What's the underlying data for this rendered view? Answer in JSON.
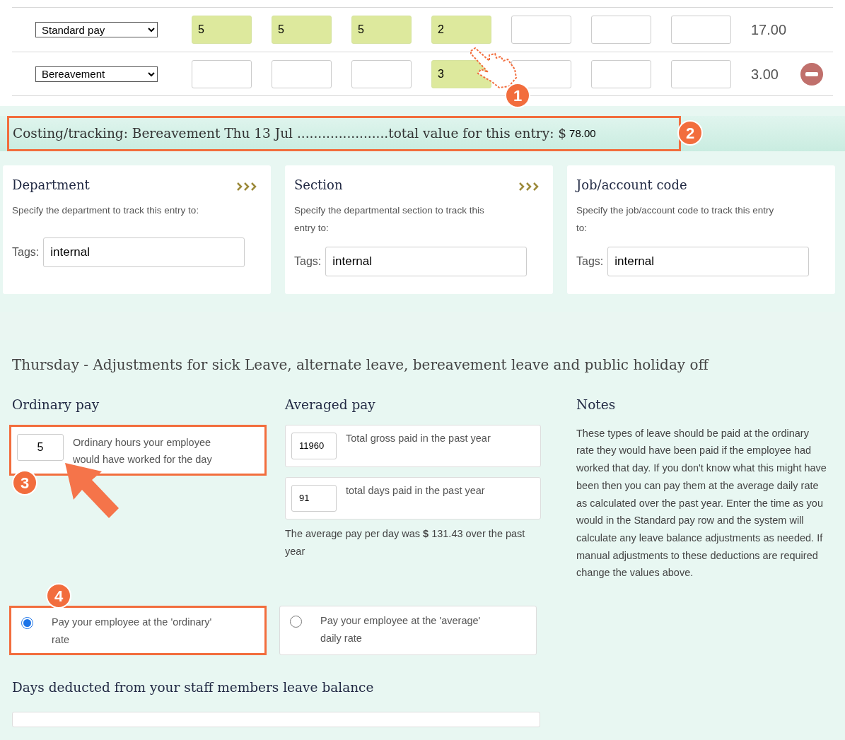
{
  "pay_rows": [
    {
      "type": "Standard pay",
      "cells": [
        {
          "value": "5",
          "filled": true
        },
        {
          "value": "5",
          "filled": true
        },
        {
          "value": "5",
          "filled": true
        },
        {
          "value": "2",
          "filled": true
        },
        {
          "filled": false
        },
        {
          "filled": false
        },
        {
          "filled": false
        }
      ],
      "total": "17.00",
      "removable": false
    },
    {
      "type": "Bereavement",
      "cells": [
        {
          "filled": false
        },
        {
          "filled": false
        },
        {
          "filled": false
        },
        {
          "value": "3",
          "filled": true
        },
        {
          "filled": false
        },
        {
          "filled": false
        },
        {
          "filled": false
        }
      ],
      "total": "3.00",
      "removable": true,
      "callout": "1"
    }
  ],
  "costing": {
    "text": "Costing/tracking: Bereavement Thu 13 Jul ......................total value for this entry: $",
    "amount": "78.00",
    "callout": "2"
  },
  "tracking_cards": [
    {
      "title": "Department",
      "description": "Specify the department to track this entry to:",
      "tags_label": "Tags:",
      "tags": "internal",
      "expand": true
    },
    {
      "title": "Section",
      "description": "Specify the departmental section to track this entry to:",
      "tags_label": "Tags:",
      "tags": "internal",
      "expand": true
    },
    {
      "title": "Job/account code",
      "description": "Specify the job/account code to track this entry to:",
      "tags_label": "Tags:",
      "tags": "internal",
      "expand": false
    }
  ],
  "adjustments": {
    "heading": "Thursday - Adjustments for sick Leave, alternate leave, bereavement leave and public holiday off",
    "ordinary": {
      "heading": "Ordinary pay",
      "hours": "5",
      "description": "Ordinary hours your employee would have worked for the day",
      "callout": "3"
    },
    "averaged": {
      "heading": "Averaged pay",
      "fields": [
        {
          "value": "11960",
          "label": "Total gross paid in the past year"
        },
        {
          "value": "91",
          "label": "total days paid in the past year"
        }
      ],
      "summary": "The average pay per day was **$** 131.43  over the past year"
    },
    "notes": {
      "heading": "Notes",
      "text": "These types of leave should be paid at the ordinary rate they would have been paid if the employee had worked that day. If you don't know what this might have been then you can pay them at the average daily rate as calculated over the past year. Enter the time as you would in the Standard pay row and the system will calculate any leave balance adjustments as needed. If manual adjustments to these deductions are required change the values above."
    },
    "rate_options": [
      {
        "label": "Pay your employee at the 'ordinary' rate",
        "selected": true,
        "callout": "4"
      },
      {
        "label": "Pay your employee at the 'average' daily rate",
        "selected": false
      }
    ],
    "balance": {
      "heading": "Days deducted from your staff members leave balance"
    }
  }
}
